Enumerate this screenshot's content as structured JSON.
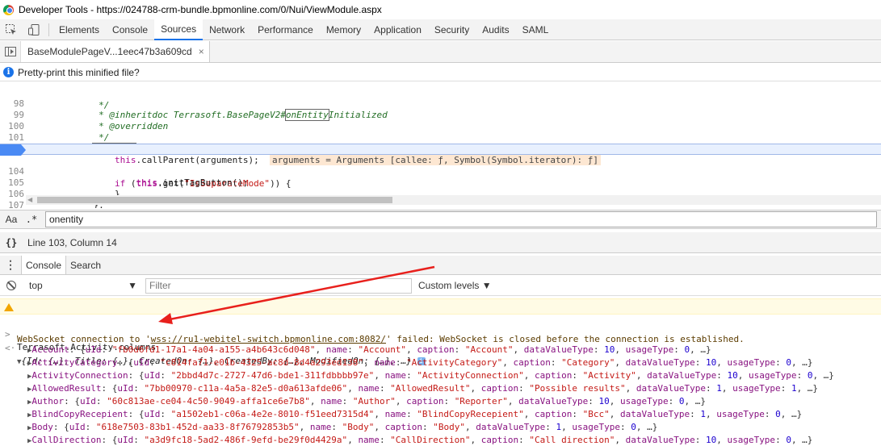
{
  "window": {
    "title": "Developer Tools - https://024788-crm-bundle.bpmonline.com/0/Nui/ViewModule.aspx"
  },
  "toolbar": {
    "tabs": [
      "Elements",
      "Console",
      "Sources",
      "Network",
      "Performance",
      "Memory",
      "Application",
      "Security",
      "Audits",
      "SAML"
    ],
    "active_tab": "Sources"
  },
  "file_tab": {
    "name": "BaseModulePageV...1eec47b3a609cd",
    "close": "×"
  },
  "infobar": {
    "text": "Pretty-print this minified file?"
  },
  "editor": {
    "lines": [
      {
        "n": "",
        "text": "             */"
      },
      {
        "n": "98",
        "text": "             * @inheritdoc Terrasoft.BasePageV2#onEntityInitialized"
      },
      {
        "n": "99",
        "text": "             * @overridden"
      },
      {
        "n": "100",
        "text": "             */"
      },
      {
        "n": "101",
        "text": "            onEntityInitialized: function() {"
      },
      {
        "n": "102",
        "text": "                this.callParent(arguments);"
      },
      {
        "n": "103",
        "text": "                if (this.get(\"IsSeparateMode\")) {"
      },
      {
        "n": "104",
        "text": "                    this.initTagButton();"
      },
      {
        "n": "105",
        "text": "                }"
      },
      {
        "n": "106",
        "text": "            },"
      },
      {
        "n": "107",
        "text": ""
      },
      {
        "n": "108",
        "text": ""
      }
    ],
    "inline_value": "arguments = Arguments [callee: ƒ, Symbol(Symbol.iterator): ƒ]",
    "highlight_word": "onEntity"
  },
  "search": {
    "match_case_label": "Aa",
    "regex_label": ".*",
    "value": "onentity"
  },
  "status": {
    "pretty_print_label": "{}",
    "cursor": "Line 103, Column 14"
  },
  "drawer": {
    "tabs": [
      "Console",
      "Search"
    ],
    "active": "Console"
  },
  "console_toolbar": {
    "context": "top",
    "filter_placeholder": "Filter",
    "levels": "Custom levels ▼"
  },
  "console": {
    "warning": {
      "prefix": "WebSocket connection to '",
      "url": "wss://ru1-webitel-switch.bpmonline.com:8082/",
      "suffix": "' failed: WebSocket is closed before the connection is established."
    },
    "input": "Terrasoft.Activity.columns",
    "result_summary": "{Id: {…}, Title: {…}, CreatedOn: {…}, CreatedBy: {…}, ModifiedOn: {…}, …}",
    "info_badge": "i",
    "rows": [
      {
        "key": "Account",
        "uId": "\"fb0d6fd1-17a1-4a04-a155-a4b643c6d048\"",
        "name": "\"Account\"",
        "caption": "\"Account\"",
        "dvt": "10",
        "usage": "0"
      },
      {
        "key": "ActivityCategory",
        "uId": "\"c814fa71-e01b-4325-ac8d-8d4a293ed138\"",
        "name": "\"ActivityCategory\"",
        "caption": "\"Category\"",
        "dvt": "10",
        "usage": "0"
      },
      {
        "key": "ActivityConnection",
        "uId": "\"2bbd4d7c-2727-47d6-bde1-311fdbbbb97e\"",
        "name": "\"ActivityConnection\"",
        "caption": "\"Activity\"",
        "dvt": "10",
        "usage": "0"
      },
      {
        "key": "AllowedResult",
        "uId": "\"7bb00970-c11a-4a5a-82e5-d0a613afde06\"",
        "name": "\"AllowedResult\"",
        "caption": "\"Possible results\"",
        "dvt": "1",
        "usage": "1"
      },
      {
        "key": "Author",
        "uId": "\"60c813ae-ce04-4c50-9049-affa1ce6e7b8\"",
        "name": "\"Author\"",
        "caption": "\"Reporter\"",
        "dvt": "10",
        "usage": "0"
      },
      {
        "key": "BlindCopyRecepient",
        "uId": "\"a1502eb1-c06a-4e2e-8010-f51eed7315d4\"",
        "name": "\"BlindCopyRecepient\"",
        "caption": "\"Bcc\"",
        "dvt": "1",
        "usage": "0"
      },
      {
        "key": "Body",
        "uId": "\"618e7503-83b1-452d-aa33-8f76792853b5\"",
        "name": "\"Body\"",
        "caption": "\"Body\"",
        "dvt": "1",
        "usage": "0"
      },
      {
        "key": "CallDirection",
        "uId": "\"a3d9fc18-5ad2-486f-9efd-be29f0d4429a\"",
        "name": "\"CallDirection\"",
        "caption": "\"Call direction\"",
        "dvt": "10",
        "usage": "0"
      }
    ]
  },
  "colors": {
    "accent": "#1a73e8",
    "annotation_arrow": "#e8201c",
    "warning_bg": "#fffbe5"
  }
}
